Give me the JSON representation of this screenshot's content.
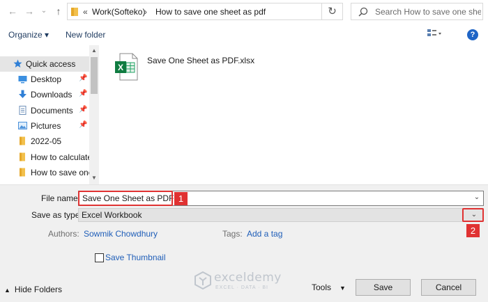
{
  "address_bar": {
    "crumb_prefix": "«",
    "crumbs": [
      "Work(Softeko)",
      "How to save one sheet as pdf"
    ],
    "separator": "›",
    "search_placeholder": "Search How to save one she..."
  },
  "command_bar": {
    "organize_label": "Organize ▾",
    "new_folder_label": "New folder",
    "help_label": "?"
  },
  "nav_pane": {
    "items": [
      {
        "label": "Quick access",
        "icon": "star-icon"
      },
      {
        "label": "Desktop",
        "icon": "desktop-icon",
        "pinned": true
      },
      {
        "label": "Downloads",
        "icon": "download-icon",
        "pinned": true
      },
      {
        "label": "Documents",
        "icon": "documents-icon",
        "pinned": true
      },
      {
        "label": "Pictures",
        "icon": "pictures-icon",
        "pinned": true
      },
      {
        "label": "2022-05",
        "icon": "folder-icon"
      },
      {
        "label": "How to calculate",
        "icon": "folder-icon"
      },
      {
        "label": "How to save one",
        "icon": "folder-icon"
      }
    ]
  },
  "files": [
    {
      "name": "Save One Sheet as PDF.xlsx",
      "icon": "excel-file-icon"
    }
  ],
  "form": {
    "file_name_label": "File name:",
    "file_name_value": "Save One Sheet as PDF",
    "save_as_type_label": "Save as type:",
    "save_as_type_value": "Excel Workbook",
    "authors_label": "Authors:",
    "authors_value": "Sowmik Chowdhury",
    "tags_label": "Tags:",
    "tags_value": "Add a tag",
    "thumbnail_label": "Save Thumbnail",
    "thumbnail_checked": false
  },
  "annotations": {
    "badge_1": "1",
    "badge_2": "2",
    "color": "#e03232"
  },
  "footer": {
    "hide_folders_label": "Hide Folders",
    "tools_label": "Tools",
    "save_label": "Save",
    "cancel_label": "Cancel"
  },
  "watermark": {
    "name": "exceldemy",
    "tagline": "EXCEL · DATA · BI"
  }
}
